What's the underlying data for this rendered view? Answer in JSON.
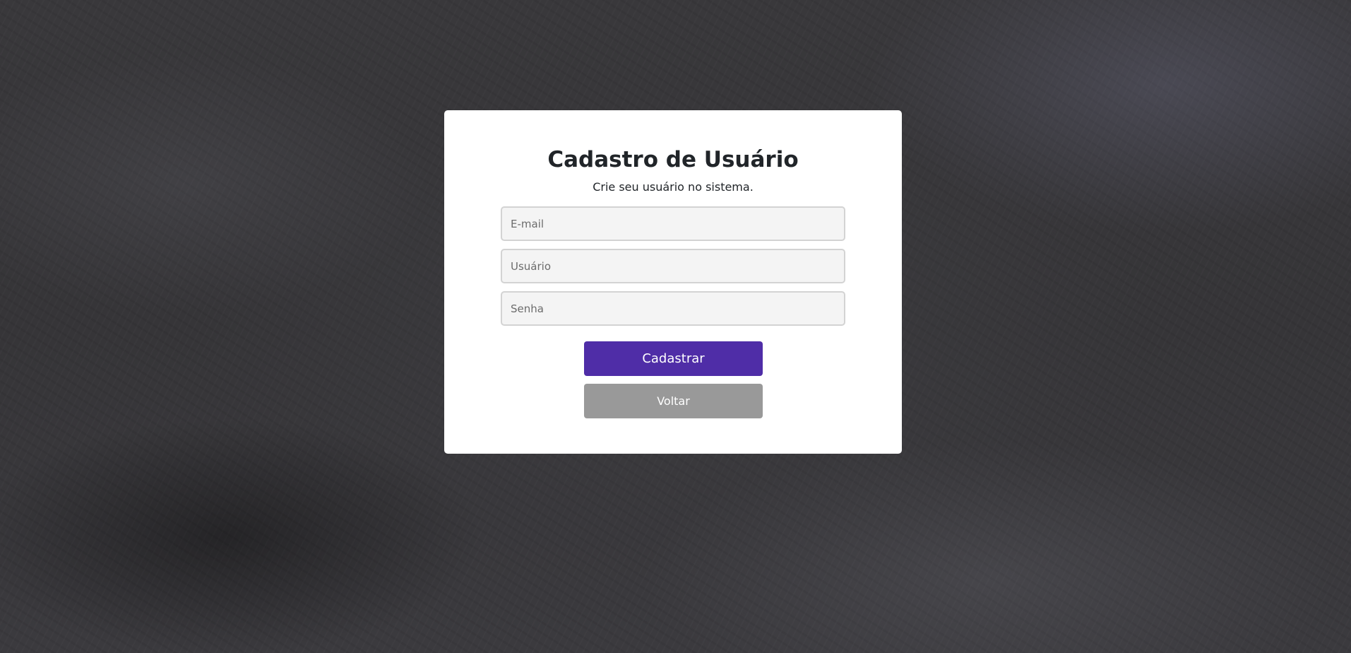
{
  "form": {
    "title": "Cadastro de Usuário",
    "subtitle": "Crie seu usuário no sistema.",
    "email": {
      "placeholder": "E-mail",
      "value": ""
    },
    "username": {
      "placeholder": "Usuário",
      "value": ""
    },
    "password": {
      "placeholder": "Senha",
      "value": ""
    },
    "submit_label": "Cadastrar",
    "back_label": "Voltar"
  },
  "colors": {
    "background": "#3a393c",
    "card": "#ffffff",
    "primary": "#4f2da7",
    "secondary": "#999999",
    "input_bg": "#f4f4f4",
    "input_border": "#d3d3d3"
  }
}
